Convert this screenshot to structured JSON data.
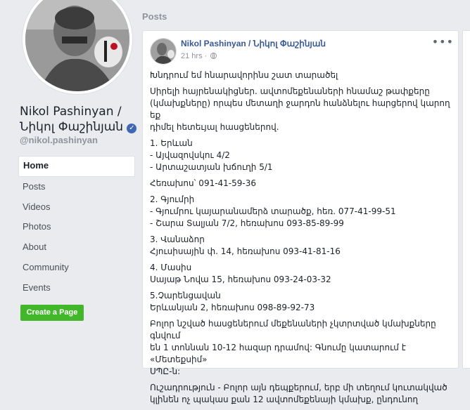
{
  "profile": {
    "name_line1": "Nikol Pashinyan /",
    "name_line2": "Նիկոլ Փաշինյան",
    "username": "@nikol.pashinyan",
    "verified_icon": "verified-badge-icon"
  },
  "nav": {
    "items": [
      {
        "label": "Home",
        "active": true
      },
      {
        "label": "Posts"
      },
      {
        "label": "Videos"
      },
      {
        "label": "Photos"
      },
      {
        "label": "About"
      },
      {
        "label": "Community"
      },
      {
        "label": "Events"
      }
    ],
    "create_page_label": "Create a Page"
  },
  "posts_section": {
    "title": "Posts"
  },
  "post": {
    "author": "Nikol Pashinyan / Նիկոլ Փաշինյան",
    "time": "21 hrs",
    "privacy_icon": "globe-icon",
    "more_icon": "more-options-icon",
    "paragraphs": [
      [
        "Խնդրում եմ հնարավորինս շատ տարածել"
      ],
      [
        "Սիրելի հայրենակիցներ. ավտոմեքենաների հնամաշ թափքերը",
        "(կմախքները) որպես մետաղի ջարդոն հանձնելու հարցերով կարող եք",
        "դիմել հետեւյալ հասցեներով."
      ],
      [
        "1. Երևան",
        "- Այվազովսկու 4/2",
        "- Արտաշատյան խճուղի 5/1"
      ],
      [
        "Հեռախոս՝ 091-41-59-36"
      ],
      [
        "2. Գյումրի",
        "- Գյումրու կայարանամերձ տարածք, հեռ. 077-41-99-51",
        "- Շարա Տալյան 7/2, հեռախոս 093-85-89-99"
      ],
      [
        "3. Վանաձոր",
        "Հյուսիսային փ. 14, հեռախոս 093-41-81-16"
      ],
      [
        "4. Մասիս",
        "Սայաթ Նովա 15, հեռախոս 093-24-03-32"
      ],
      [
        "5.Չարենցավան",
        "Երևանյան 2, հեռախոս 098-89-92-73"
      ],
      [
        "Բոլոր նշված հասցեներում մեքենաների չկտրտված կմախքները գնվում",
        "են 1 տոննան 10-12 հազար դրամով: Գնումը կատարում է «Մետեքսիմ»",
        "ՍՊԸ-ն:"
      ],
      [
        "Ուշադրություն - Բոլոր այն դեպքերում, երբ մի տեղում կուտակված",
        "կլինեն ոչ պակաս քան 12 ավտոմեքենայի կմախք, ընդունող"
      ]
    ]
  },
  "colors": {
    "background": "#e9ebee",
    "link": "#385898",
    "create_button": "#42b72a"
  }
}
